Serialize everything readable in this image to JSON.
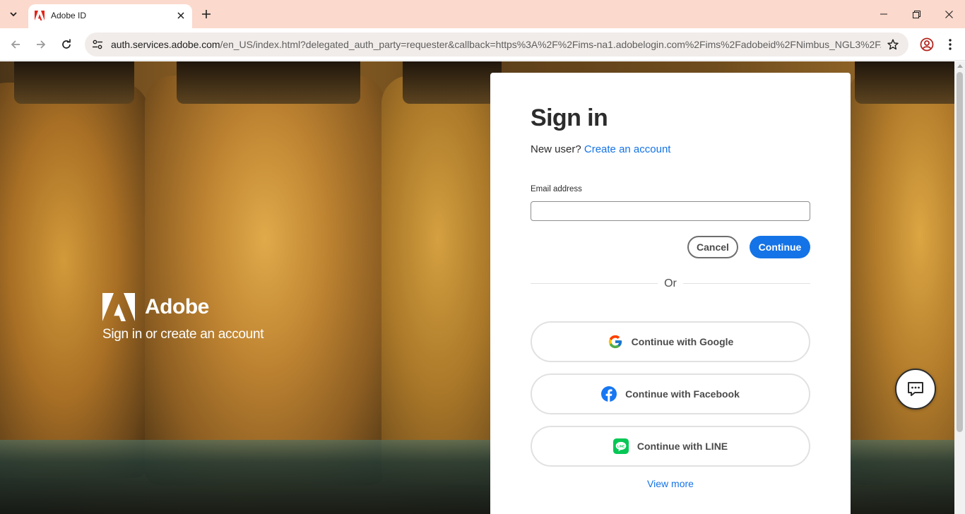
{
  "browser": {
    "tab_title": "Adobe ID",
    "url_host": "auth.services.adobe.com",
    "url_rest": "/en_US/index.html?delegated_auth_party=requester&callback=https%3A%2F%2Fims-na1.adobelogin.com%2Fims%2Fadobeid%2FNimbus_NGL3%2F..."
  },
  "brand": {
    "name": "Adobe",
    "tagline": "Sign in or create an account"
  },
  "signin": {
    "title": "Sign in",
    "new_user_text": "New user?",
    "create_account_link": "Create an account",
    "email_label": "Email address",
    "email_value": "",
    "cancel_label": "Cancel",
    "continue_label": "Continue",
    "or_text": "Or",
    "google_label": "Continue with Google",
    "facebook_label": "Continue with Facebook",
    "line_label": "Continue with LINE",
    "view_more": "View more"
  },
  "colors": {
    "accent": "#1473e6",
    "tabbar": "#fbd9cc"
  }
}
